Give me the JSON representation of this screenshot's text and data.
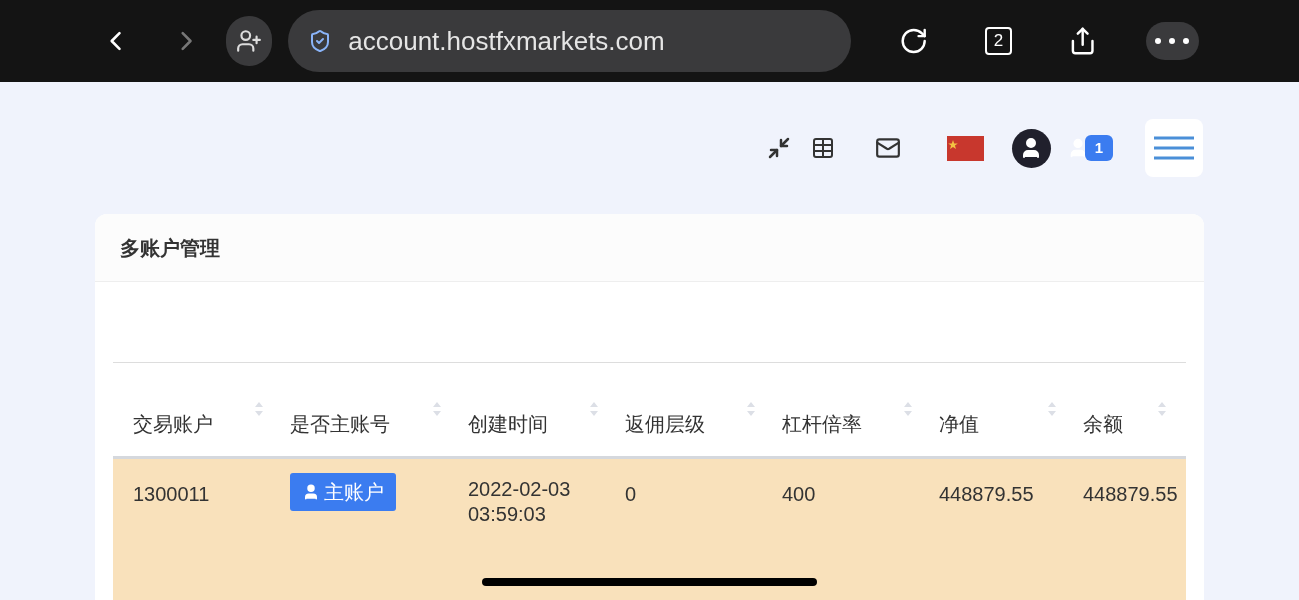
{
  "browser": {
    "url": "account.hostfxmarkets.com",
    "tab_count": "2"
  },
  "header": {
    "notification_count": "1"
  },
  "card": {
    "title": "多账户管理"
  },
  "table": {
    "columns": [
      "交易账户",
      "是否主账号",
      "创建时间",
      "返佣层级",
      "杠杆倍率",
      "净值",
      "余额"
    ],
    "rows": [
      {
        "selected": true,
        "account": "1300011",
        "main_badge": "主账户",
        "created": [
          "2022-02-03",
          "03:59:03"
        ],
        "rebate_level": "0",
        "leverage": "400",
        "equity": "448879.55",
        "balance": "448879.55"
      }
    ]
  }
}
